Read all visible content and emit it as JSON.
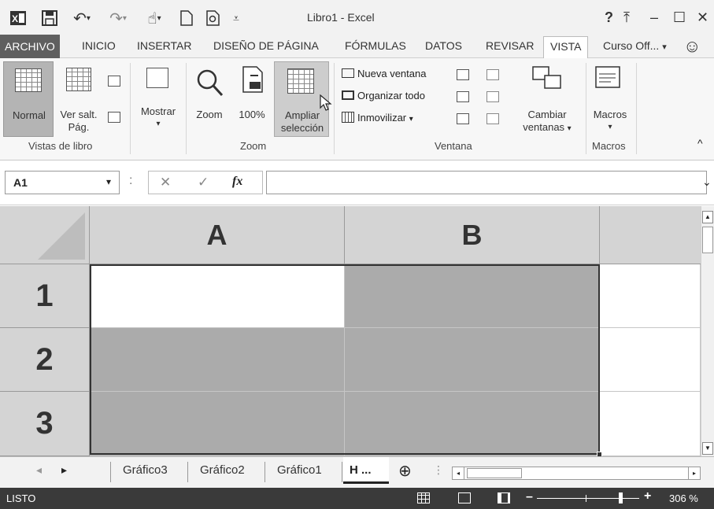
{
  "title": "Libro1 - Excel",
  "window": {
    "help": "?",
    "ribbon_display": "⤒",
    "minimize": "–",
    "maximize": "☐",
    "close": "✕"
  },
  "menu": {
    "tabs": [
      "ARCHIVO",
      "INICIO",
      "INSERTAR",
      "DISEÑO DE PÁGINA",
      "FÓRMULAS",
      "DATOS",
      "REVISAR",
      "VISTA"
    ],
    "account": "Curso Off...",
    "active": "VISTA"
  },
  "ribbon": {
    "vistas": {
      "normal": "Normal",
      "ver_salt_1": "Ver salt.",
      "ver_salt_2": "Pág.",
      "group": "Vistas de libro"
    },
    "mostrar": {
      "label": "Mostrar",
      "arrow": "▾"
    },
    "zoom": {
      "zoom": "Zoom",
      "pct": "100%",
      "ampliar_1": "Ampliar",
      "ampliar_2": "selección",
      "group": "Zoom"
    },
    "ventana": {
      "nueva": "Nueva ventana",
      "organizar": "Organizar todo",
      "inmovilizar": "Inmovilizar",
      "arrow": "▾",
      "cambiar_1": "Cambiar",
      "cambiar_2": "ventanas",
      "group": "Ventana"
    },
    "macros": {
      "label": "Macros",
      "arrow": "▾",
      "group": "Macros"
    },
    "collapse": "^"
  },
  "formula_bar": {
    "name_box": "A1",
    "dropdown": "▾",
    "colon": ":",
    "cancel": "✕",
    "enter": "✓",
    "fx": "fx",
    "expand": "⌄",
    "value": ""
  },
  "grid": {
    "columns": [
      "A",
      "B"
    ],
    "rows": [
      "1",
      "2",
      "3"
    ]
  },
  "sheets": {
    "tabs": [
      "Gráfico3",
      "Gráfico2",
      "Gráfico1"
    ],
    "active_partial": "H ...",
    "nav_prev": "◂",
    "nav_next": "▸",
    "add": "⊕",
    "more": "⋮"
  },
  "status": {
    "text": "LISTO",
    "zoom": "306 %",
    "minus": "–",
    "plus": "+"
  }
}
